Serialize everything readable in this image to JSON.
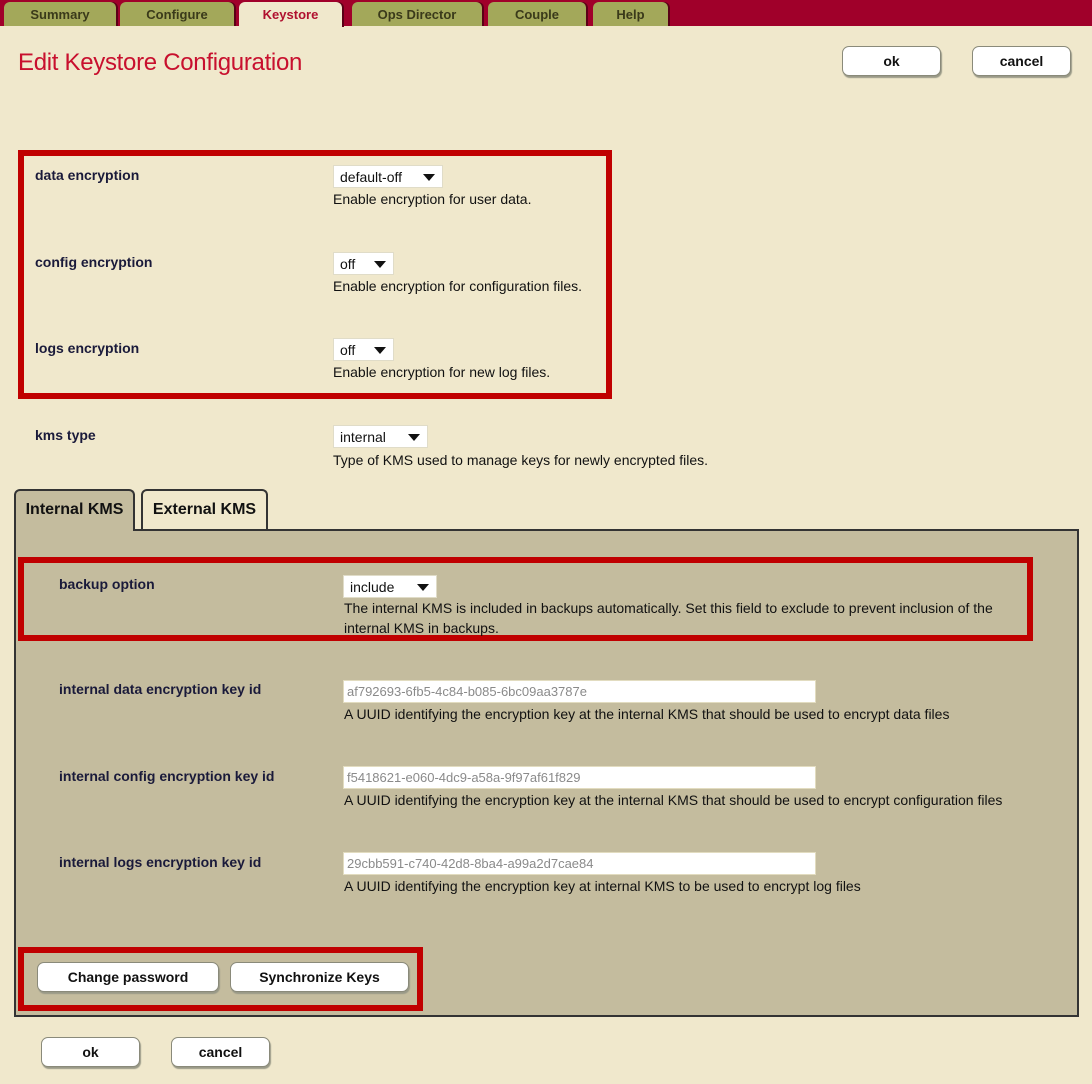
{
  "nav": {
    "tabs": [
      {
        "label": "Summary",
        "active": false
      },
      {
        "label": "Configure",
        "active": false
      },
      {
        "label": "Keystore",
        "active": true
      },
      {
        "label": "Ops Director",
        "active": false
      },
      {
        "label": "Couple",
        "active": false
      },
      {
        "label": "Help",
        "active": false
      }
    ]
  },
  "header": {
    "title": "Edit Keystore Configuration",
    "ok_label": "ok",
    "cancel_label": "cancel"
  },
  "encryption": {
    "data": {
      "label": "data encryption",
      "value": "default-off",
      "help": "Enable encryption for user data."
    },
    "config": {
      "label": "config encryption",
      "value": "off",
      "help": "Enable encryption for configuration files."
    },
    "logs": {
      "label": "logs encryption",
      "value": "off",
      "help": "Enable encryption for new log files."
    }
  },
  "kms_type": {
    "label": "kms type",
    "value": "internal",
    "help": "Type of KMS used to manage keys for newly encrypted files."
  },
  "kms_tabs": [
    {
      "label": "Internal KMS",
      "active": true
    },
    {
      "label": "External KMS",
      "active": false
    }
  ],
  "internal_kms": {
    "backup": {
      "label": "backup option",
      "value": "include",
      "help_line1": "The internal KMS is included in backups automatically. Set this field to exclude to prevent inclusion of the",
      "help_line2": "internal KMS in backups."
    },
    "data_key": {
      "label": "internal data encryption key id",
      "value": "af792693-6fb5-4c84-b085-6bc09aa3787e",
      "help": "A UUID identifying the encryption key at the internal KMS that should be used to encrypt data files"
    },
    "config_key": {
      "label": "internal config encryption key id",
      "value": "f5418621-e060-4dc9-a58a-9f97af61f829",
      "help": "A UUID identifying the encryption key at the internal KMS that should be used to encrypt configuration files"
    },
    "logs_key": {
      "label": "internal logs encryption key id",
      "value": "29cbb591-c740-42d8-8ba4-a99a2d7cae84",
      "help": "A UUID identifying the encryption key at internal KMS to be used to encrypt log files"
    },
    "change_password_label": "Change password",
    "sync_keys_label": "Synchronize Keys"
  },
  "footer": {
    "ok_label": "ok",
    "cancel_label": "cancel"
  },
  "colors": {
    "brand": "#a0002a",
    "title": "#c8102e",
    "highlight_box": "#c00000",
    "page_bg": "#f0e8cc",
    "panel_bg": "#c4bc9e"
  }
}
